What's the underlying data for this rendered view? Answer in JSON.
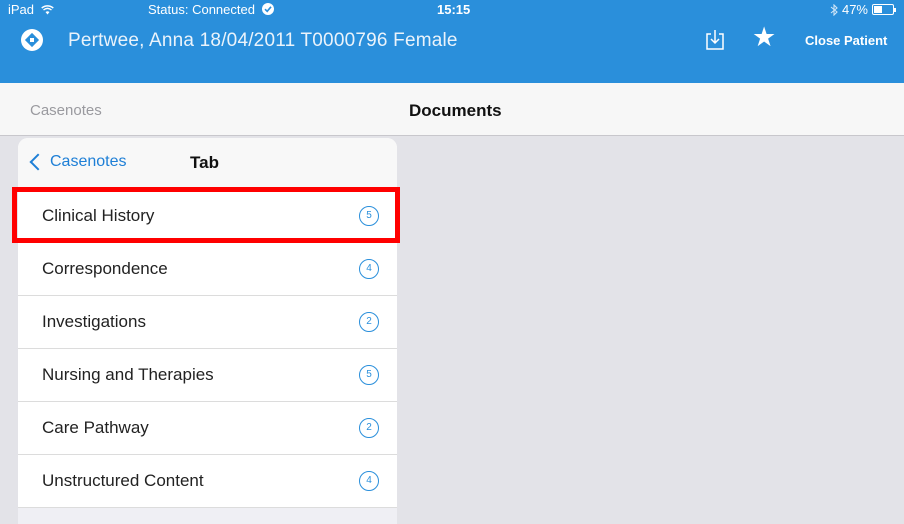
{
  "statusbar": {
    "carrier": "iPad",
    "wifi_icon": "wifi-icon",
    "status": "Status: Connected",
    "status_icon": "check-circle-icon",
    "time": "15:15",
    "bluetooth_icon": "bluetooth-icon",
    "battery": "47%",
    "battery_level": 0.47
  },
  "patient": {
    "info": "Pertwee, Anna  18/04/2011  T0000796  Female",
    "close_label": "Close Patient",
    "logo_icon": "app-logo-icon",
    "download_icon": "download-icon",
    "star_icon": "star-icon"
  },
  "nav": {
    "back_label": "Casenotes",
    "title": "Documents"
  },
  "popover": {
    "back_label": "Casenotes",
    "title": "Tab",
    "items": [
      {
        "label": "Clinical History",
        "count": "5"
      },
      {
        "label": "Correspondence",
        "count": "4"
      },
      {
        "label": "Investigations",
        "count": "2"
      },
      {
        "label": "Nursing and Therapies",
        "count": "5"
      },
      {
        "label": "Care Pathway",
        "count": "2"
      },
      {
        "label": "Unstructured Content",
        "count": "4"
      }
    ]
  },
  "colors": {
    "brand_blue": "#2a8fdb",
    "highlight_red": "#ff0000"
  }
}
